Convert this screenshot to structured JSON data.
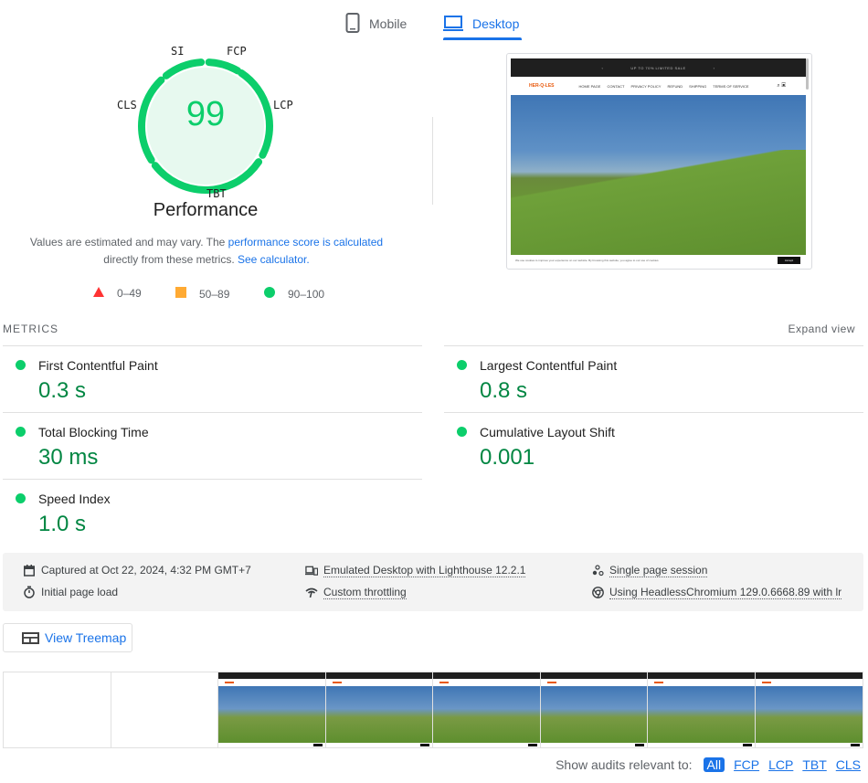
{
  "tabs": [
    {
      "label": "Mobile",
      "icon": "phone-icon",
      "active": false
    },
    {
      "label": "Desktop",
      "icon": "laptop-icon",
      "active": true
    }
  ],
  "gauge": {
    "score": "99",
    "title": "Performance",
    "labels": {
      "si": "SI",
      "fcp": "FCP",
      "lcp": "LCP",
      "tbt": "TBT",
      "cls": "CLS"
    },
    "color": "#0cce6b",
    "fill_color": "#e7f9ef"
  },
  "description": {
    "text1": "Values are estimated and may vary. The ",
    "link1": "performance score is calculated",
    "text2": " directly from these metrics. ",
    "link2": "See calculator."
  },
  "legend": [
    {
      "shape": "triangle",
      "range": "0–49",
      "color": "#ff3333"
    },
    {
      "shape": "square",
      "range": "50–89",
      "color": "#ffaa33"
    },
    {
      "shape": "circle",
      "range": "90–100",
      "color": "#0cce6b"
    }
  ],
  "preview": {
    "banner": "UP TO 70% LIMITED SALE",
    "logo": "HER-Q-LES",
    "nav_links": [
      "HOME PAGE",
      "CONTACT",
      "PRIVACY POLICY",
      "REFUND",
      "SHIPPING",
      "TERMS OF SERVICE"
    ],
    "cookie_text": "We use cookies to improve your experience on our website. By browsing this website, you agree to our use of cookies.",
    "accept": "Accept"
  },
  "metrics": {
    "header": "METRICS",
    "expand": "Expand view",
    "items": [
      {
        "name": "First Contentful Paint",
        "value": "0.3 s",
        "status": "pass"
      },
      {
        "name": "Largest Contentful Paint",
        "value": "0.8 s",
        "status": "pass"
      },
      {
        "name": "Total Blocking Time",
        "value": "30 ms",
        "status": "pass"
      },
      {
        "name": "Cumulative Layout Shift",
        "value": "0.001",
        "status": "pass"
      },
      {
        "name": "Speed Index",
        "value": "1.0 s",
        "status": "pass"
      }
    ]
  },
  "info": {
    "captured": "Captured at Oct 22, 2024, 4:32 PM GMT+7",
    "initial_load": "Initial page load",
    "emulated": "Emulated Desktop with Lighthouse 12.2.1",
    "throttling": "Custom throttling",
    "session": "Single page session",
    "browser": "Using HeadlessChromium 129.0.6668.89 with lr"
  },
  "treemap": {
    "label": "View Treemap"
  },
  "filmstrip": {
    "frames": [
      false,
      false,
      true,
      true,
      true,
      true,
      true,
      true
    ]
  },
  "audits": {
    "label": "Show audits relevant to:",
    "filters": [
      "All",
      "FCP",
      "LCP",
      "TBT",
      "CLS"
    ]
  }
}
